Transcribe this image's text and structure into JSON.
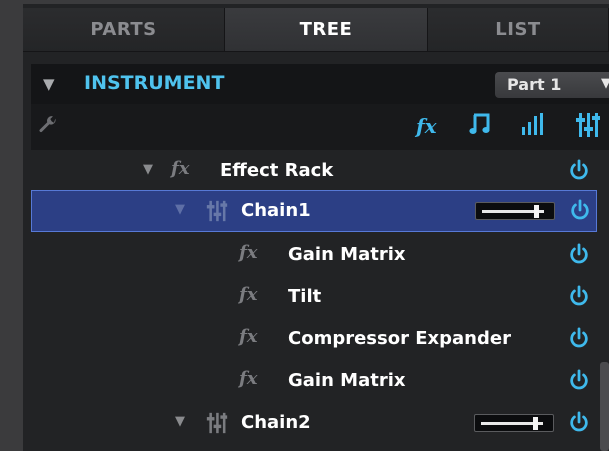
{
  "tabs": [
    {
      "label": "PARTS",
      "active": false
    },
    {
      "label": "TREE",
      "active": true
    },
    {
      "label": "LIST",
      "active": false
    }
  ],
  "header": {
    "title": "INSTRUMENT",
    "part_select": {
      "value": "Part 1"
    }
  },
  "toolbar": {
    "fx_icon": "fx",
    "icons": [
      "wrench-icon",
      "fx-icon",
      "music-note-icon",
      "level-bars-icon",
      "mixer-sliders-icon"
    ]
  },
  "tree": {
    "rows": [
      {
        "label": "Effect Rack",
        "type": "fx",
        "fx_glyph": "fx",
        "expanded": true,
        "selected": false,
        "power": "on"
      },
      {
        "label": "Chain1",
        "type": "chain",
        "expanded": true,
        "selected": true,
        "level": 0.9,
        "power": "on"
      },
      {
        "label": "Gain Matrix",
        "type": "fx",
        "fx_glyph": "fx",
        "power": "on"
      },
      {
        "label": "Tilt",
        "type": "fx",
        "fx_glyph": "fx",
        "power": "on"
      },
      {
        "label": "Compressor Expander",
        "type": "fx",
        "fx_glyph": "fx",
        "power": "on"
      },
      {
        "label": "Gain Matrix",
        "type": "fx",
        "fx_glyph": "fx",
        "power": "on"
      },
      {
        "label": "Chain2",
        "type": "chain",
        "expanded": true,
        "selected": false,
        "level": 0.9,
        "power": "on"
      }
    ]
  },
  "colors": {
    "accent": "#3fb9ec",
    "selection": "#2c3f85",
    "panel": "#222325"
  }
}
